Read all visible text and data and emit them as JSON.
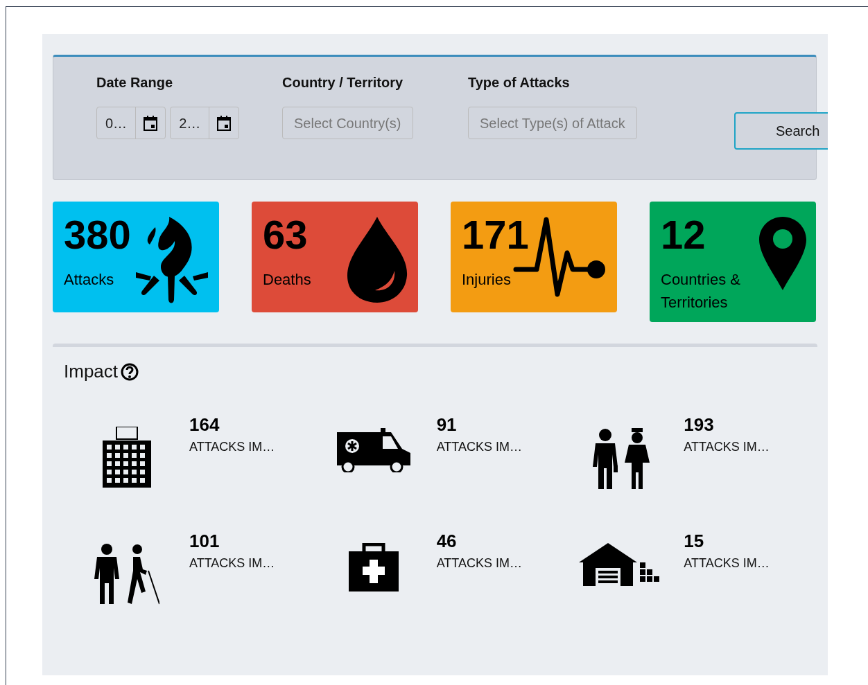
{
  "filters": [
    {
      "label": "Date Range",
      "kind": "dates",
      "values": [
        "0…",
        "2…"
      ]
    },
    {
      "label": "Country / Territory",
      "kind": "select",
      "placeholder": "Select Country(s)"
    },
    {
      "label": "Type of Attacks",
      "kind": "select",
      "placeholder": "Select Type(s) of Attack"
    }
  ],
  "search_button": "Search",
  "stats": [
    {
      "value": "380",
      "label": "Attacks",
      "kind": "fire",
      "color": "#00c0ef"
    },
    {
      "value": "63",
      "label": "Deaths",
      "kind": "drop",
      "color": "#dd4b39"
    },
    {
      "value": "171",
      "label": "Injuries",
      "kind": "pulse",
      "color": "#f39c12"
    },
    {
      "value": "12",
      "label": "Countries & Territories",
      "kind": "pin",
      "color": "#00a65a"
    }
  ],
  "impact": {
    "title": "Impact",
    "items": [
      {
        "value": "164",
        "label": "ATTACKS IM…",
        "kind": "hospital"
      },
      {
        "value": "91",
        "label": "ATTACKS IM…",
        "kind": "ambulance"
      },
      {
        "value": "193",
        "label": "ATTACKS IM…",
        "kind": "staff"
      },
      {
        "value": "101",
        "label": "ATTACKS IM…",
        "kind": "patients"
      },
      {
        "value": "46",
        "label": "ATTACKS IM…",
        "kind": "kit"
      },
      {
        "value": "15",
        "label": "ATTACKS IM…",
        "kind": "warehouse"
      }
    ]
  }
}
